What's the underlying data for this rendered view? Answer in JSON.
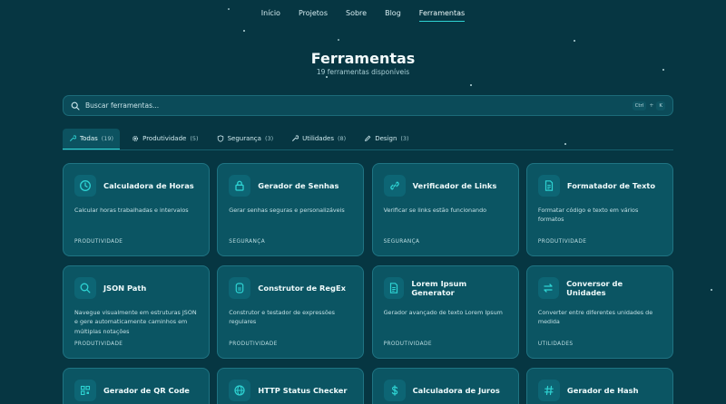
{
  "nav": {
    "items": [
      {
        "label": "Início"
      },
      {
        "label": "Projetos"
      },
      {
        "label": "Sobre"
      },
      {
        "label": "Blog"
      },
      {
        "label": "Ferramentas",
        "active": true
      }
    ]
  },
  "hero": {
    "title": "Ferramentas",
    "subtitle": "19 ferramentas disponíveis"
  },
  "search": {
    "placeholder": "Buscar ferramentas...",
    "shortcut_ctrl": "Ctrl",
    "shortcut_plus": "+",
    "shortcut_key": "K"
  },
  "tabs": [
    {
      "label": "Todas",
      "count": "(19)",
      "icon": "wrench-icon",
      "active": true
    },
    {
      "label": "Produtividade",
      "count": "(5)",
      "icon": "gear-icon"
    },
    {
      "label": "Segurança",
      "count": "(3)",
      "icon": "shield-icon"
    },
    {
      "label": "Utilidades",
      "count": "(8)",
      "icon": "wrench-icon"
    },
    {
      "label": "Design",
      "count": "(3)",
      "icon": "pencil-icon"
    }
  ],
  "tools": [
    {
      "title": "Calculadora de Horas",
      "desc": "Calcular horas trabalhadas e intervalos",
      "category": "PRODUTIVIDADE",
      "icon": "clock-icon"
    },
    {
      "title": "Gerador de Senhas",
      "desc": "Gerar senhas seguras e personalizáveis",
      "category": "SEGURANÇA",
      "icon": "lock-icon"
    },
    {
      "title": "Verificador de Links",
      "desc": "Verificar se links estão funcionando",
      "category": "SEGURANÇA",
      "icon": "link-icon"
    },
    {
      "title": "Formatador de Texto",
      "desc": "Formatar código e texto em vários formatos",
      "category": "PRODUTIVIDADE",
      "icon": "document-icon"
    },
    {
      "title": "JSON Path",
      "desc": "Navegue visualmente em estruturas JSON e gere automaticamente caminhos em múltiplas notações",
      "category": "PRODUTIVIDADE",
      "icon": "search-icon"
    },
    {
      "title": "Construtor de RegEx",
      "desc": "Construtor e testador de expressões regulares",
      "category": "PRODUTIVIDADE",
      "icon": "regex-icon"
    },
    {
      "title": "Lorem Ipsum Generator",
      "desc": "Gerador avançado de texto Lorem Ipsum",
      "category": "PRODUTIVIDADE",
      "icon": "document-icon"
    },
    {
      "title": "Conversor de Unidades",
      "desc": "Converter entre diferentes unidades de medida",
      "category": "UTILIDADES",
      "icon": "swap-icon"
    },
    {
      "title": "Gerador de QR Code",
      "desc": "",
      "category": "",
      "icon": "qr-code-icon"
    },
    {
      "title": "HTTP Status Checker",
      "desc": "",
      "category": "",
      "icon": "globe-icon"
    },
    {
      "title": "Calculadora de Juros",
      "desc": "",
      "category": "",
      "icon": "dollar-icon"
    },
    {
      "title": "Gerador de Hash",
      "desc": "",
      "category": "",
      "icon": "hash-icon"
    }
  ],
  "colors": {
    "background": "#063642",
    "card": "#0b5563",
    "accent": "#2ed3d3"
  }
}
